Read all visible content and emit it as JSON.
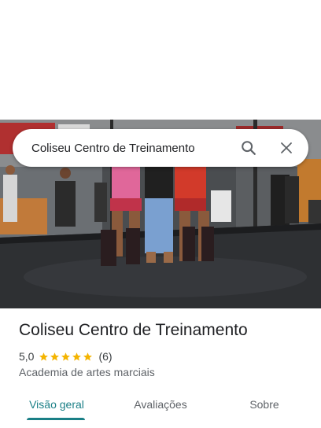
{
  "search": {
    "query": "Coliseu Centro de Treinamento"
  },
  "icons": {
    "search": "search-icon",
    "close": "close-icon",
    "star": "star-icon"
  },
  "place": {
    "name": "Coliseu Centro de Treinamento",
    "rating": "5,0",
    "stars_filled": 5,
    "review_count": "(6)",
    "category": "Academia de artes marciais"
  },
  "tabs": [
    {
      "label": "Visão geral",
      "active": true
    },
    {
      "label": "Avaliações",
      "active": false
    },
    {
      "label": "Sobre",
      "active": false
    }
  ],
  "colors": {
    "accent": "#1a7f86",
    "star": "#f4b400",
    "text": "#202124",
    "muted": "#5f6368"
  }
}
